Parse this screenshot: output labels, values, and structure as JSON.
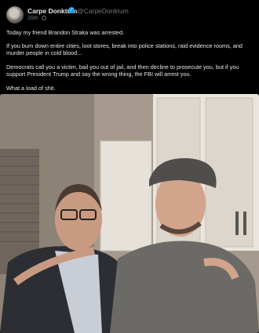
{
  "post": {
    "display_name": "Carpe Donktum",
    "handle": "@CarpeDonktum",
    "timestamp": "20m",
    "paragraphs": [
      "Today my friend Brandon Straka was arrested.",
      "If you burn down entire cities, loot stores, break into police stations, raid evidence rooms, and murder people in cold blood...",
      "Democrats call you a victim, bail you out of jail, and then decline to prosecute you, but if you support President Trump and say the wrong thing, the FBI will arrest you.",
      "What a load of shit."
    ]
  },
  "icons": {
    "verified": "verified-badge-icon",
    "audience": "globe-icon"
  },
  "colors": {
    "background": "#000000",
    "text": "#e7e9ea",
    "secondary_text": "#71767b",
    "verified": "#1d9bf0"
  }
}
